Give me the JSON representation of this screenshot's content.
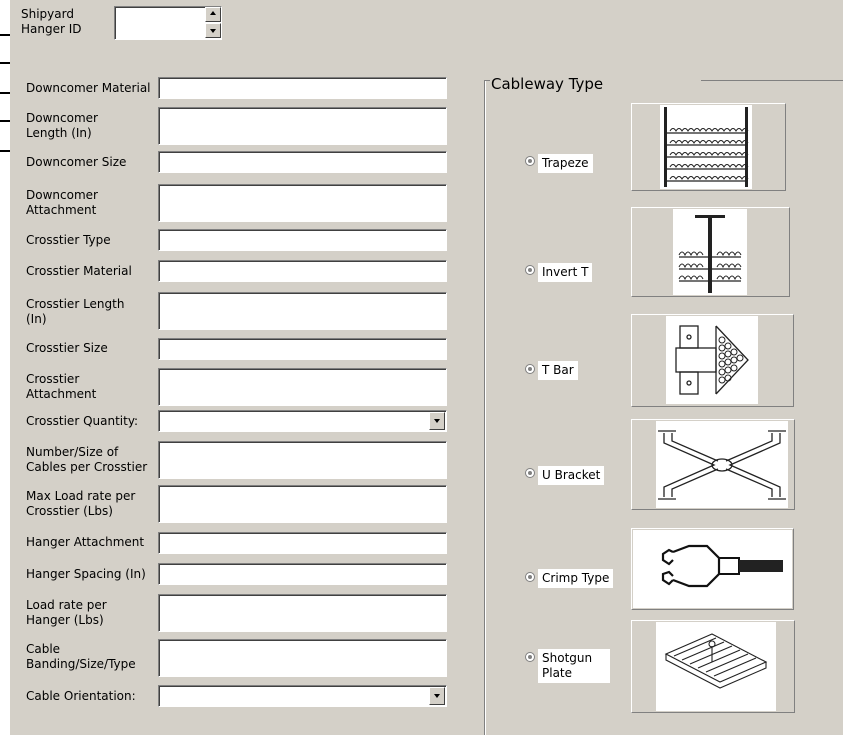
{
  "header": {
    "hanger_id_label": "Shipyard\nHanger ID",
    "hanger_id_value": ""
  },
  "fields": [
    {
      "label": "Downcomer Material",
      "value": "",
      "kind": "text"
    },
    {
      "label": "Downcomer\nLength (In)",
      "value": "",
      "kind": "text"
    },
    {
      "label": "Downcomer Size",
      "value": "",
      "kind": "text"
    },
    {
      "label": "Downcomer\nAttachment",
      "value": "",
      "kind": "text"
    },
    {
      "label": "Crosstier Type",
      "value": "",
      "kind": "text"
    },
    {
      "label": "Crosstier Material",
      "value": "",
      "kind": "text"
    },
    {
      "label": "Crosstier Length\n(In)",
      "value": "",
      "kind": "text"
    },
    {
      "label": "Crosstier Size",
      "value": "",
      "kind": "text"
    },
    {
      "label": "Crosstier\nAttachment",
      "value": "",
      "kind": "text"
    },
    {
      "label": "Crosstier Quantity:",
      "value": "",
      "kind": "combo"
    },
    {
      "label": "Number/Size of\nCables per Crosstier",
      "value": "",
      "kind": "text"
    },
    {
      "label": "Max Load rate per\nCrosstier (Lbs)",
      "value": "",
      "kind": "text"
    },
    {
      "label": "Hanger Attachment",
      "value": "",
      "kind": "text"
    },
    {
      "label": "Hanger Spacing (In)",
      "value": "",
      "kind": "text"
    },
    {
      "label": "Load rate per\nHanger (Lbs)",
      "value": "",
      "kind": "text"
    },
    {
      "label": "Cable\nBanding/Size/Type",
      "value": "",
      "kind": "text"
    },
    {
      "label": "Cable Orientation:",
      "value": "",
      "kind": "combo"
    }
  ],
  "cableway": {
    "title": "Cableway Type",
    "options": [
      {
        "label": "Trapeze",
        "icon": "trapeze-image"
      },
      {
        "label": "Invert T",
        "icon": "invert-t-image"
      },
      {
        "label": "T Bar",
        "icon": "t-bar-image"
      },
      {
        "label": "U Bracket",
        "icon": "u-bracket-image"
      },
      {
        "label": "Crimp Type",
        "icon": "crimp-type-image"
      },
      {
        "label": "Shotgun\nPlate",
        "icon": "shotgun-plate-image"
      }
    ]
  }
}
